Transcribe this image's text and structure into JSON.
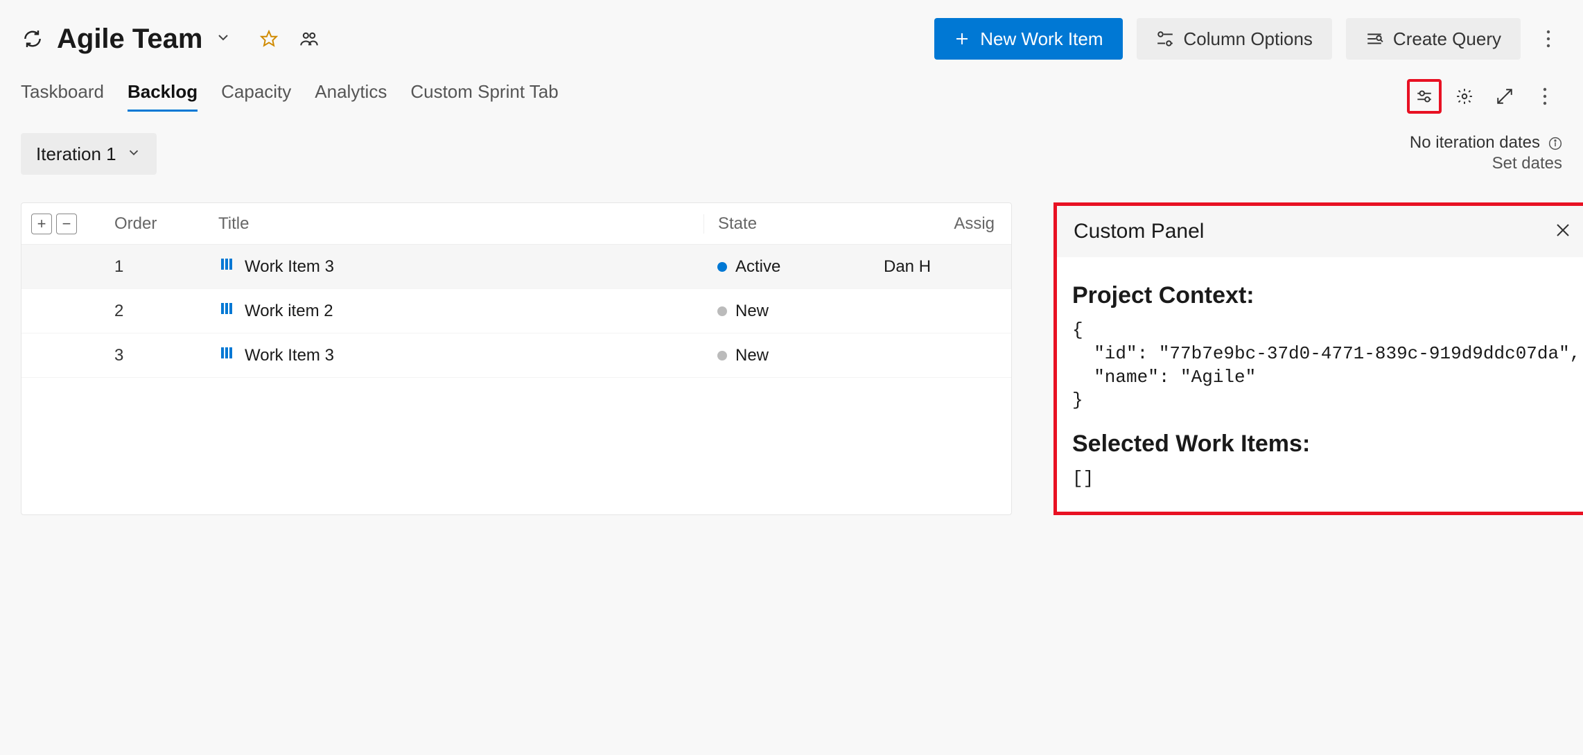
{
  "header": {
    "team_name": "Agile Team"
  },
  "buttons": {
    "new_work_item": "New Work Item",
    "column_options": "Column Options",
    "create_query": "Create Query"
  },
  "tabs": {
    "taskboard": "Taskboard",
    "backlog": "Backlog",
    "capacity": "Capacity",
    "analytics": "Analytics",
    "custom_sprint": "Custom Sprint Tab"
  },
  "iteration": {
    "label": "Iteration 1",
    "no_dates": "No iteration dates",
    "set_dates": "Set dates"
  },
  "grid": {
    "headers": {
      "order": "Order",
      "title": "Title",
      "state": "State",
      "assigned": "Assig"
    },
    "rows": [
      {
        "order": "1",
        "title": "Work Item 3",
        "state": "Active",
        "state_kind": "active",
        "assigned": "Dan H"
      },
      {
        "order": "2",
        "title": "Work item 2",
        "state": "New",
        "state_kind": "new",
        "assigned": ""
      },
      {
        "order": "3",
        "title": "Work Item 3",
        "state": "New",
        "state_kind": "new",
        "assigned": ""
      }
    ]
  },
  "panel": {
    "title": "Custom Panel",
    "h_context": "Project Context:",
    "context_json": "{\n  \"id\": \"77b7e9bc-37d0-4771-839c-919d9ddc07da\",\n  \"name\": \"Agile\"\n}",
    "h_selected": "Selected Work Items:",
    "selected_json": "[]"
  }
}
